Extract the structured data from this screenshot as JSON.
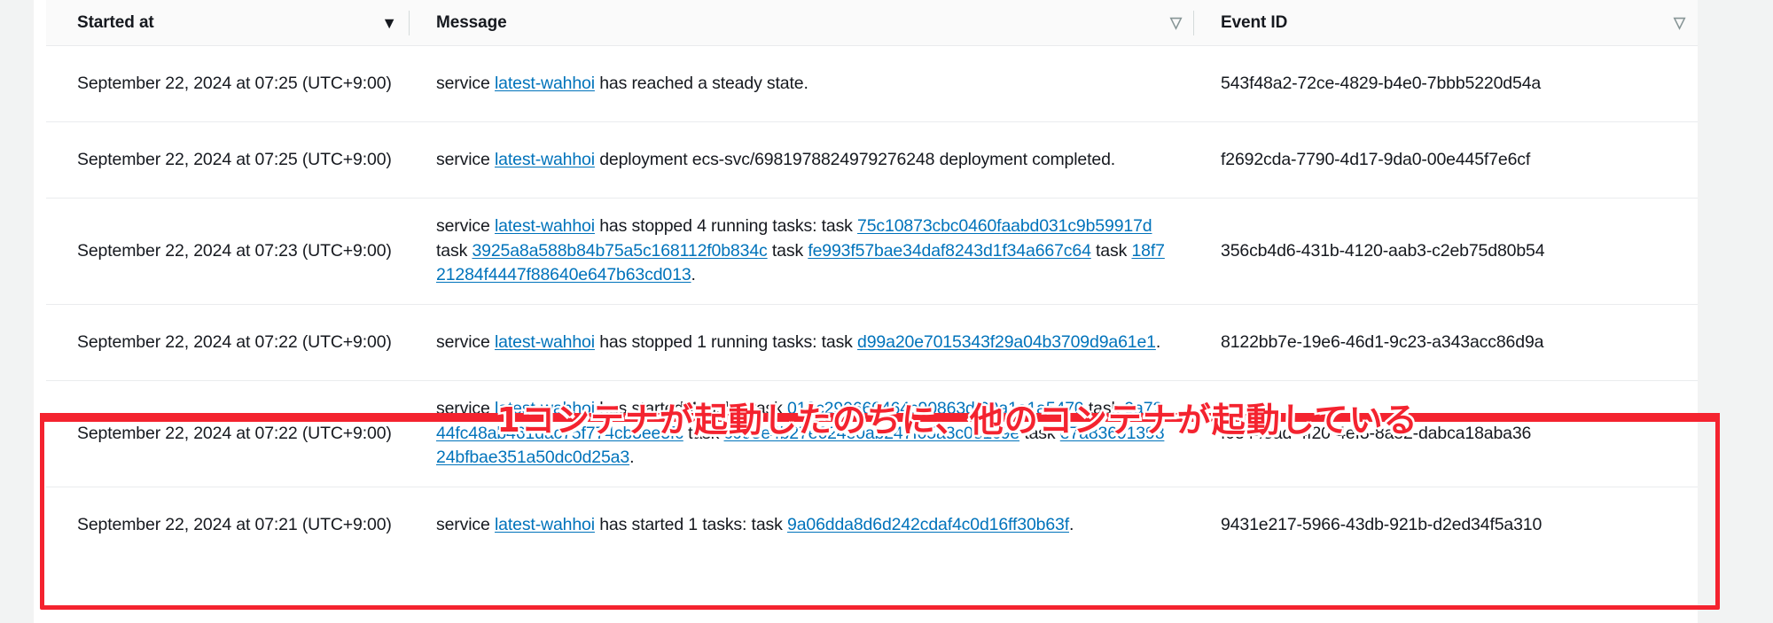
{
  "table": {
    "columns": [
      {
        "key": "started_at",
        "label": "Started at",
        "sort_icon": "sort-descending-filled-icon"
      },
      {
        "key": "message",
        "label": "Message",
        "sort_icon": "sort-hollow-icon"
      },
      {
        "key": "event_id",
        "label": "Event ID",
        "sort_icon": "sort-hollow-icon"
      }
    ],
    "rows": [
      {
        "started_at": "September 22, 2024 at 07:25 (UTC+9:00)",
        "message_parts": [
          {
            "t": "text",
            "v": "service "
          },
          {
            "t": "link",
            "v": "latest-wahhoi"
          },
          {
            "t": "text",
            "v": " has reached a steady state."
          }
        ],
        "event_id": "543f48a2-72ce-4829-b4e0-7bbb5220d54a",
        "highlighted": false
      },
      {
        "started_at": "September 22, 2024 at 07:25 (UTC+9:00)",
        "message_parts": [
          {
            "t": "text",
            "v": "service "
          },
          {
            "t": "link",
            "v": "latest-wahhoi"
          },
          {
            "t": "text",
            "v": " deployment ecs-svc/6981978824979276248 deployment completed."
          }
        ],
        "event_id": "f2692cda-7790-4d17-9da0-00e445f7e6cf",
        "highlighted": false
      },
      {
        "started_at": "September 22, 2024 at 07:23 (UTC+9:00)",
        "message_parts": [
          {
            "t": "text",
            "v": "service "
          },
          {
            "t": "link",
            "v": "latest-wahhoi"
          },
          {
            "t": "text",
            "v": " has stopped 4 running tasks: task "
          },
          {
            "t": "link",
            "v": "75c10873cbc0460faabd031c9b59917d"
          },
          {
            "t": "text",
            "v": " task "
          },
          {
            "t": "link",
            "v": "3925a8a588b84b75a5c168112f0b834c"
          },
          {
            "t": "text",
            "v": " task "
          },
          {
            "t": "link",
            "v": "fe993f57bae34daf8243d1f34a667c64"
          },
          {
            "t": "text",
            "v": " task "
          },
          {
            "t": "link",
            "v": "18f721284f4447f88640e647b63cd013"
          },
          {
            "t": "text",
            "v": "."
          }
        ],
        "event_id": "356cb4d6-431b-4120-aab3-c2eb75d80b54",
        "highlighted": false
      },
      {
        "started_at": "September 22, 2024 at 07:22 (UTC+9:00)",
        "message_parts": [
          {
            "t": "text",
            "v": "service "
          },
          {
            "t": "link",
            "v": "latest-wahhoi"
          },
          {
            "t": "text",
            "v": " has stopped 1 running tasks: task "
          },
          {
            "t": "link",
            "v": "d99a20e7015343f29a04b3709d9a61e1"
          },
          {
            "t": "text",
            "v": "."
          }
        ],
        "event_id": "8122bb7e-19e6-46d1-9c23-a343acc86d9a",
        "highlighted": false
      },
      {
        "started_at": "September 22, 2024 at 07:22 (UTC+9:00)",
        "message_parts": [
          {
            "t": "text",
            "v": "service "
          },
          {
            "t": "link",
            "v": "latest-wahhoi"
          },
          {
            "t": "text",
            "v": " has started 4 tasks: task "
          },
          {
            "t": "link",
            "v": "019c290660464c90863df09a1a1a5470"
          },
          {
            "t": "text",
            "v": " task "
          },
          {
            "t": "link",
            "v": "9a7244fc48ab461dac75f774cb3ee3fc"
          },
          {
            "t": "text",
            "v": " task "
          },
          {
            "t": "link",
            "v": "c093e4b27e624e0ab247f05a3c081c9e"
          },
          {
            "t": "text",
            "v": " task "
          },
          {
            "t": "link",
            "v": "e7a8369139824bfbae351a50dc0d25a3"
          },
          {
            "t": "text",
            "v": "."
          }
        ],
        "event_id": "f03443ad-4f20-4ef3-8a82-dabca18aba36",
        "highlighted": true
      },
      {
        "started_at": "September 22, 2024 at 07:21 (UTC+9:00)",
        "message_parts": [
          {
            "t": "text",
            "v": "service "
          },
          {
            "t": "link",
            "v": "latest-wahhoi"
          },
          {
            "t": "text",
            "v": " has started 1 tasks: task "
          },
          {
            "t": "link",
            "v": "9a06dda8d6d242cdaf4c0d16ff30b63f"
          },
          {
            "t": "text",
            "v": "."
          }
        ],
        "event_id": "9431e217-5966-43db-921b-d2ed34f5a310",
        "highlighted": true
      }
    ]
  },
  "annotation": {
    "note_text": "1コンテナが起動したのちに、他のコンテナが起動している",
    "color": "#f4232f"
  },
  "colors": {
    "link": "#0073bb",
    "header_bg": "#fafafa",
    "text": "#16191f",
    "border": "#e9ebed",
    "page_bg": "#f2f3f3"
  }
}
